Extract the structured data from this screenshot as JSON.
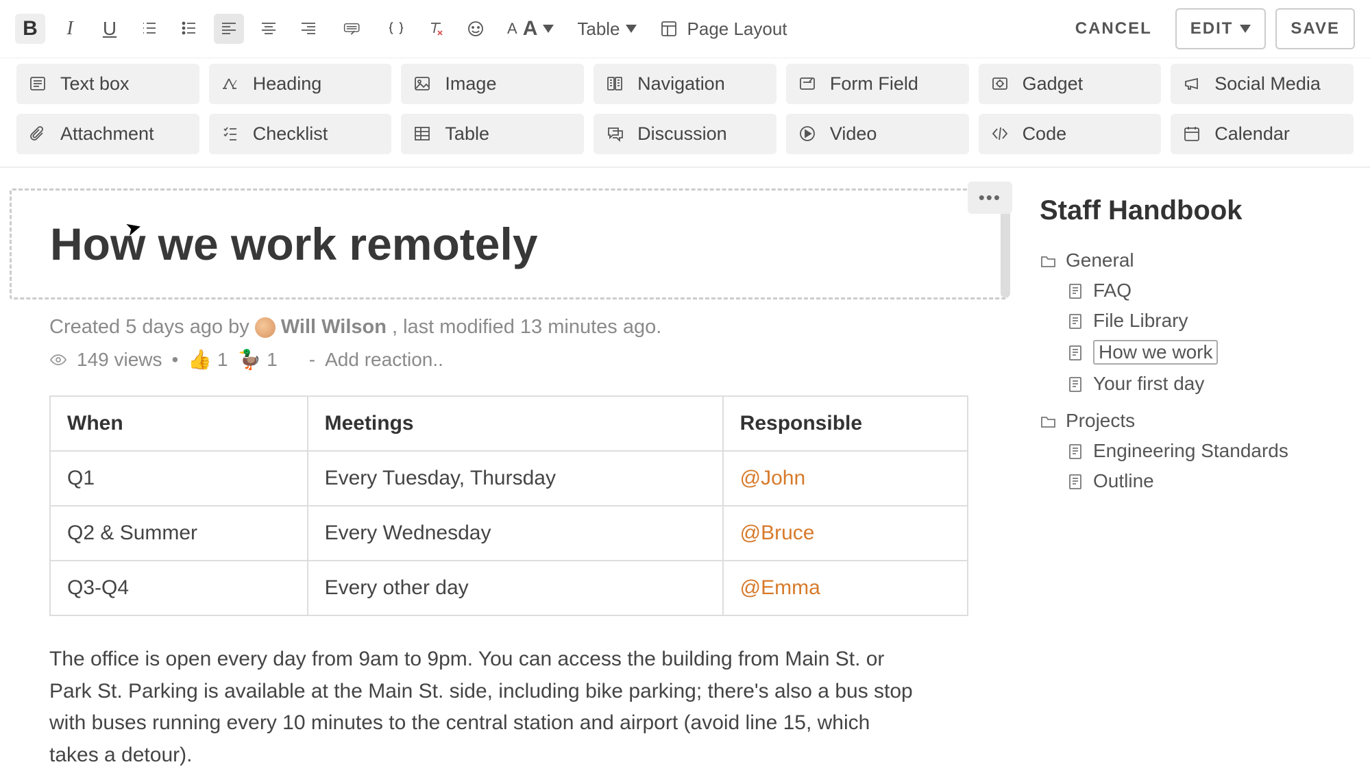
{
  "toolbar": {
    "bold": "B",
    "italic": "I",
    "underline": "U",
    "text_style_label": "A",
    "table_label": "Table",
    "page_layout_label": "Page Layout",
    "cancel": "CANCEL",
    "edit": "EDIT",
    "save": "SAVE"
  },
  "ribbon": [
    {
      "id": "textbox",
      "label": "Text box"
    },
    {
      "id": "heading",
      "label": "Heading"
    },
    {
      "id": "image",
      "label": "Image"
    },
    {
      "id": "navigation",
      "label": "Navigation"
    },
    {
      "id": "formfield",
      "label": "Form Field"
    },
    {
      "id": "gadget",
      "label": "Gadget"
    },
    {
      "id": "socialmedia",
      "label": "Social Media"
    },
    {
      "id": "attachment",
      "label": "Attachment"
    },
    {
      "id": "checklist",
      "label": "Checklist"
    },
    {
      "id": "table",
      "label": "Table"
    },
    {
      "id": "discussion",
      "label": "Discussion"
    },
    {
      "id": "video",
      "label": "Video"
    },
    {
      "id": "code",
      "label": "Code"
    },
    {
      "id": "calendar",
      "label": "Calendar"
    }
  ],
  "page": {
    "title": "How we work remotely",
    "byline_created": "Created 5 days ago by",
    "byline_author": "Will Wilson",
    "byline_modified": ", last modified 13 minutes ago.",
    "views": "149 views",
    "bullet": "•",
    "reaction_thumb": "👍",
    "reaction_thumb_count": "1",
    "reaction_bird": "🦆",
    "reaction_bird_count": "1",
    "reaction_sep": "-",
    "add_reaction": "Add reaction.."
  },
  "table": {
    "headers": [
      "When",
      "Meetings",
      "Responsible"
    ],
    "rows": [
      {
        "when": "Q1",
        "meetings": "Every Tuesday, Thursday",
        "responsible": "@John"
      },
      {
        "when": "Q2 & Summer",
        "meetings": "Every Wednesday",
        "responsible": "@Bruce"
      },
      {
        "when": "Q3-Q4",
        "meetings": "Every other day",
        "responsible": "@Emma"
      }
    ]
  },
  "body_paragraph": "The office is open every day from 9am to 9pm. You can access the building from Main St. or Park St. Parking is available at the Main St. side, including bike parking; there's also a bus stop with buses running every 10 minutes to the central station and airport (avoid line 15, which takes a detour).",
  "sidebar": {
    "title": "Staff Handbook",
    "tree": [
      {
        "type": "folder",
        "label": "General",
        "children": [
          {
            "type": "page",
            "label": "FAQ"
          },
          {
            "type": "page",
            "label": "File Library"
          },
          {
            "type": "page",
            "label": "How we work",
            "current": true
          },
          {
            "type": "page",
            "label": "Your first day"
          }
        ]
      },
      {
        "type": "folder",
        "label": "Projects",
        "children": [
          {
            "type": "page",
            "label": "Engineering Standards"
          },
          {
            "type": "page",
            "label": "Outline"
          }
        ]
      }
    ]
  },
  "more_button": "•••"
}
